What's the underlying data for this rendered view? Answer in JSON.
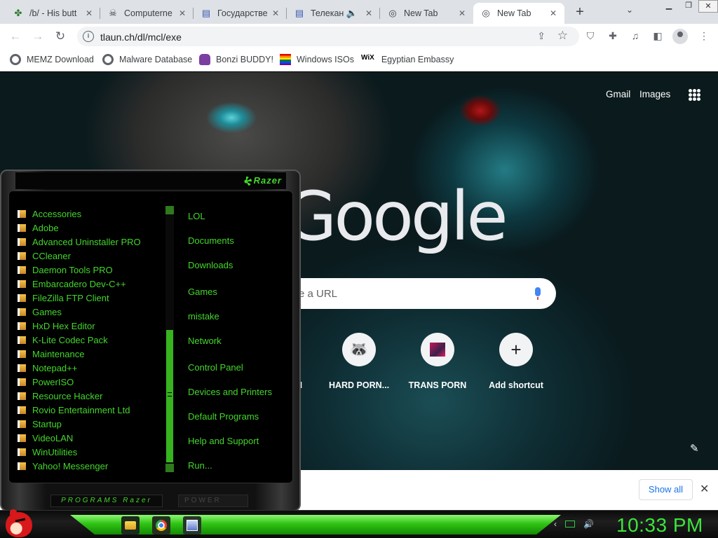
{
  "tabs": [
    {
      "title": "/b/ - His butt",
      "icon": "clover-icon"
    },
    {
      "title": "Computerne",
      "icon": "pirate-icon"
    },
    {
      "title": "Государстве",
      "icon": "book-icon"
    },
    {
      "title": "Телекан",
      "icon": "book-icon",
      "audio": "speaker-icon"
    },
    {
      "title": "New Tab",
      "icon": "chrome-icon"
    },
    {
      "title": "New Tab",
      "icon": "chrome-icon",
      "active": true
    }
  ],
  "toolbar": {
    "url": "tlaun.ch/dl/mcl/exe"
  },
  "bookmarks": [
    {
      "label": "MEMZ Download",
      "icon": "globe-icon"
    },
    {
      "label": "Malware Database",
      "icon": "globe-icon"
    },
    {
      "label": "Bonzi BUDDY!",
      "icon": "bonzi-icon"
    },
    {
      "label": "Windows ISOs",
      "icon": "rainbow-flag-icon"
    },
    {
      "label": "Egyptian Embassy",
      "icon": "wix-icon",
      "icon_text": "WiX"
    }
  ],
  "ntp": {
    "gmail": "Gmail",
    "images": "Images",
    "logo": "Google",
    "search_placeholder": "e a URL",
    "shortcuts": [
      {
        "label": "M",
        "icon": "unknown-icon"
      },
      {
        "label": "HARD PORN...",
        "icon": "raccoon-icon"
      },
      {
        "label": "TRANS PORN",
        "icon": "image-icon"
      },
      {
        "label": "Add shortcut",
        "icon": "plus-icon",
        "glyph": "+"
      }
    ],
    "show_all": "Show all"
  },
  "start_menu": {
    "brand": "Razer",
    "programs": [
      "Accessories",
      "Adobe",
      "Advanced Uninstaller PRO",
      "CCleaner",
      "Daemon Tools PRO",
      "Embarcadero Dev-C++",
      "FileZilla FTP Client",
      "Games",
      "HxD Hex Editor",
      "K-Lite Codec Pack",
      "Maintenance",
      "Notepad++",
      "PowerISO",
      "Resource Hacker",
      "Rovio Entertainment Ltd",
      "Startup",
      "VideoLAN",
      "WinUtilities",
      "Yahoo! Messenger"
    ],
    "places": [
      "LOL",
      "Documents",
      "Downloads",
      "Games",
      "mistake",
      "Network",
      "Control Panel",
      "Devices and Printers",
      "Default Programs",
      "Help and Support",
      "Run..."
    ],
    "programs_button": "PROGRAMS Razer",
    "power_button": "POWER"
  },
  "taskbar": {
    "clock": "10:33 PM"
  }
}
